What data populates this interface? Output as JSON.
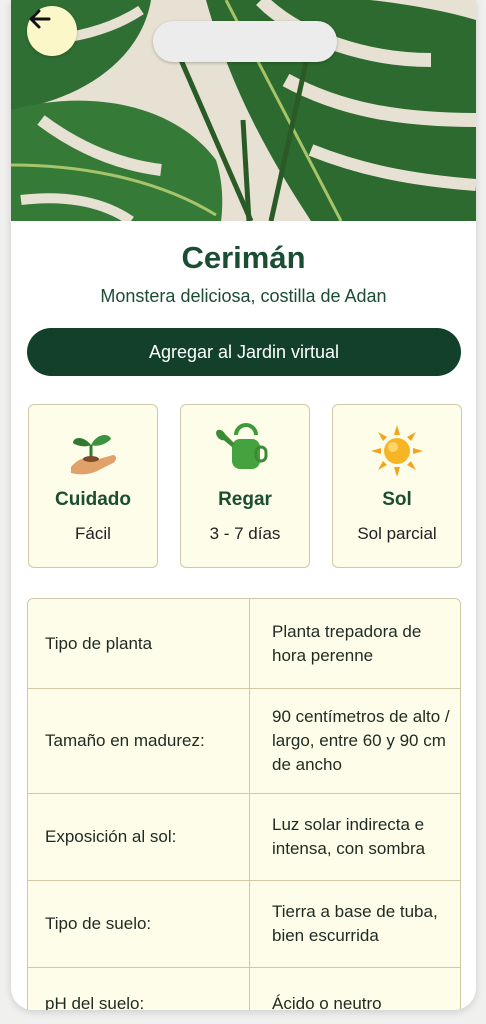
{
  "plant": {
    "name": "Cerimán",
    "scientific": "Monstera deliciosa, costilla de Adan"
  },
  "actions": {
    "add_label": "Agregar al Jardin virtual"
  },
  "cards": [
    {
      "icon": "sprout-hand-icon",
      "label": "Cuidado",
      "value": "Fácil"
    },
    {
      "icon": "watering-can-icon",
      "label": "Regar",
      "value": "3 - 7 días"
    },
    {
      "icon": "sun-icon",
      "label": "Sol",
      "value": "Sol parcial"
    }
  ],
  "details": [
    {
      "key": "Tipo de planta",
      "value": "Planta trepadora de hora perenne"
    },
    {
      "key": "Tamaño en madurez:",
      "value": "90 centímetros de alto / largo, entre 60 y 90 cm de ancho"
    },
    {
      "key": "Exposición al sol:",
      "value": "Luz solar indirecta e intensa, con sombra"
    },
    {
      "key": "Tipo de suelo:",
      "value": "Tierra a base de tuba, bien escurrida"
    },
    {
      "key": "pH del suelo:",
      "value": "Ácido o neutro"
    }
  ],
  "colors": {
    "brand_green": "#12402a",
    "card_bg": "#fdfde9",
    "back_button": "#fbf7c9"
  }
}
